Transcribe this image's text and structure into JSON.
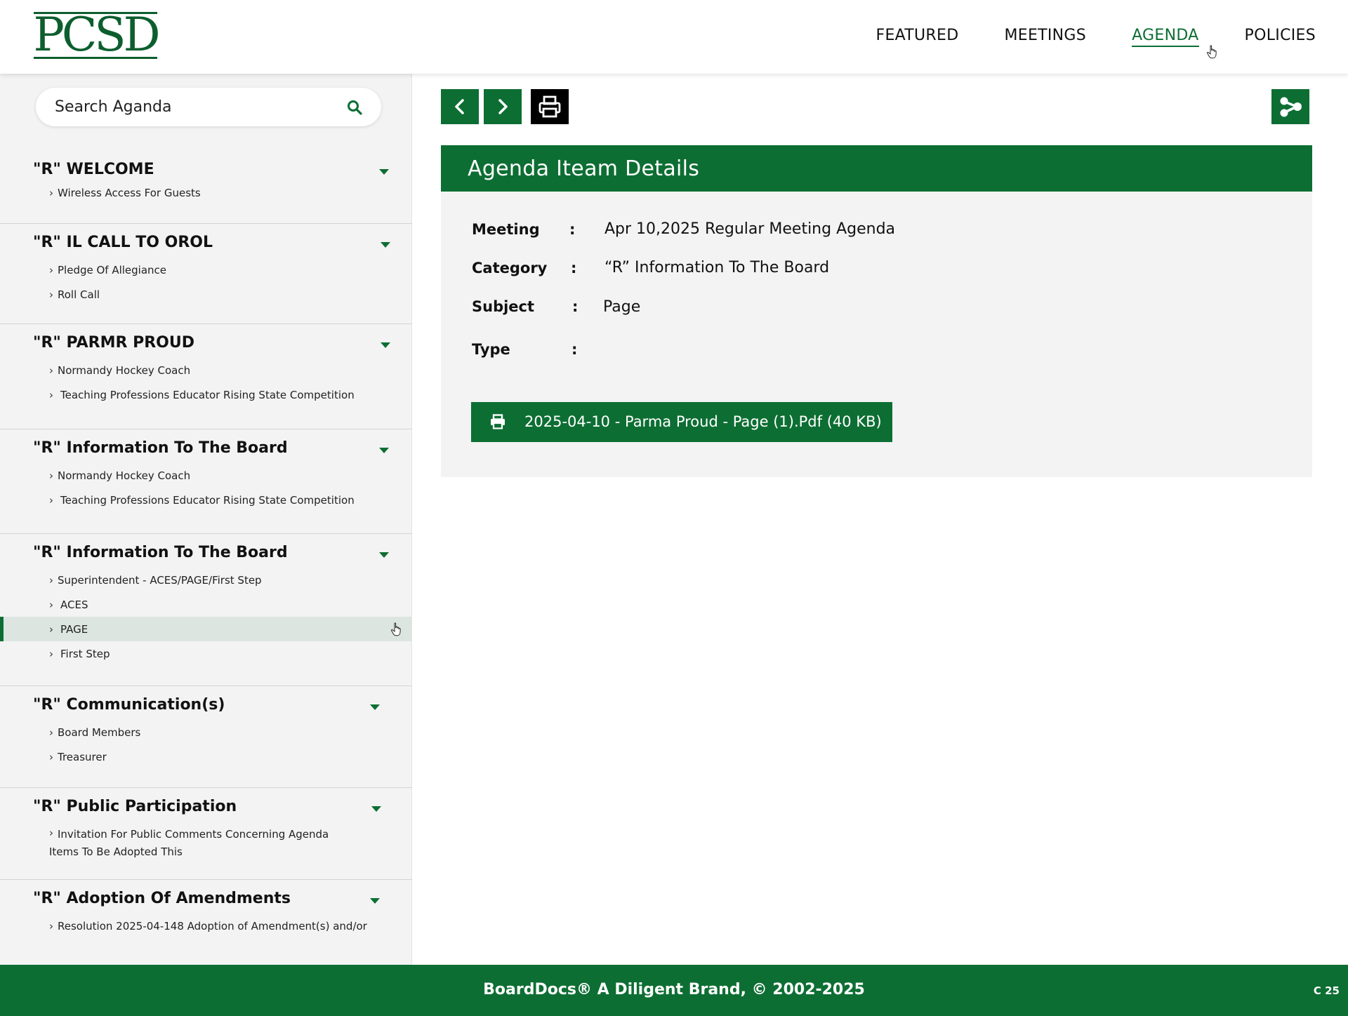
{
  "header": {
    "logo_text": "PCSD",
    "nav": [
      "FEATURED",
      "MEETINGS",
      "AGENDA",
      "POLICIES"
    ],
    "active_nav": "AGENDA"
  },
  "sidebar": {
    "search_placeholder": "Search Aganda",
    "sections": [
      {
        "title": "\"R\" WELCOME",
        "items": [
          "Wireless Access For Guests"
        ]
      },
      {
        "title": "\"R\" IL CALL TO OROL",
        "items": [
          "Pledge Of Allegiance",
          "Roll Call"
        ]
      },
      {
        "title": "\"R\" PARMR PROUD",
        "items": [
          "Normandy Hockey Coach",
          "Teaching Professions Educator Rising State Competition"
        ]
      },
      {
        "title": "\"R\" Information To The Board",
        "items": [
          "Normandy Hockey Coach",
          "Teaching Professions Educator Rising State Competition"
        ]
      },
      {
        "title": "\"R\" Information To The Board",
        "items": [
          "Superintendent - ACES/PAGE/First Step",
          "ACES",
          "PAGE",
          "First Step"
        ],
        "selected_item": "PAGE"
      },
      {
        "title": "\"R\" Communication(s)",
        "items": [
          "Board Members",
          "Treasurer"
        ]
      },
      {
        "title": "\"R\" Public Participation",
        "items": [
          "Invitation For Public Comments Concerning Agenda",
          "Items To Be Adopted This"
        ]
      },
      {
        "title": "\"R\" Adoption Of Amendments",
        "items": [
          "Resolution 2025-04-148 Adoption of Amendment(s) and/or"
        ]
      }
    ]
  },
  "toolbar": {
    "icons": [
      "chevron-left-icon",
      "chevron-right-icon",
      "printer-icon",
      "share-icon"
    ]
  },
  "details": {
    "heading": "Agenda Iteam Details",
    "separator": ":",
    "meeting_label": "Meeting",
    "meeting_value": "Apr 10,2025 Regular Meeting Agenda",
    "category_label": "Category",
    "category_value": "“R” Information To The Board",
    "subject_label": "Subject",
    "subject_value": "Page",
    "type_label": "Type",
    "type_value": "",
    "attachment": "2025-04-10 - Parma Proud - Page (1).Pdf (40 KB)"
  },
  "footer": {
    "text": "BoardDocs® A Diligent Brand, © 2002-2025",
    "version": "C 25"
  },
  "colors": {
    "brand_green": "#0d6e33",
    "logo_green": "#0d5e2e",
    "sidebar_bg": "#f3f3f3",
    "selected_bg": "#dde5e0"
  }
}
